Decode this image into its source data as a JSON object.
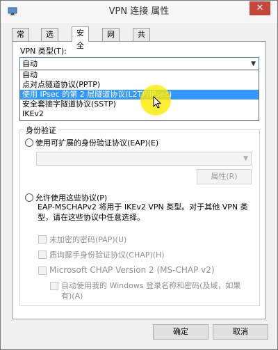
{
  "window": {
    "title": "VPN 连接 属性",
    "close_glyph": "✕"
  },
  "tabs": [
    {
      "label": "常规"
    },
    {
      "label": "选项"
    },
    {
      "label": "安全"
    },
    {
      "label": "网络"
    },
    {
      "label": "共享"
    }
  ],
  "vpn_type": {
    "label": "VPN 类型(T):",
    "selected": "自动",
    "options": [
      "自动",
      "点对点隧道协议(PPTP)",
      "使用 IPsec 的第 2 层隧道协议(L2TP/IPsec)",
      "安全套接字隧道协议(SSTP)",
      "IKEv2"
    ],
    "highlighted_index": 2
  },
  "auth": {
    "group_title": "身份验证",
    "eap_radio": "使用可扩展的身份验证协议(EAP)(E)",
    "properties_button": "属性(R)",
    "allow_radio": "允许使用这些协议(P)",
    "description": "EAP-MSCHAPv2 将用于 IKEv2 VPN 类型。对于其他 VPN 类型，请在这些协议中任意选择。",
    "pap": "未加密的密码(PAP)(U)",
    "chap": "质询握手身份验证协议(CHAP)(H)",
    "mschap": "Microsoft CHAP Version 2 (MS-CHAP v2)",
    "auto_logon": "自动使用我的 Windows 登录名称和密码(及域，如果有)(A)"
  },
  "footer": {
    "ok": "确定",
    "cancel": "取消"
  },
  "colors": {
    "selection": "#3399ff",
    "close": "#c7453b",
    "highlight": "#ffeb00"
  }
}
